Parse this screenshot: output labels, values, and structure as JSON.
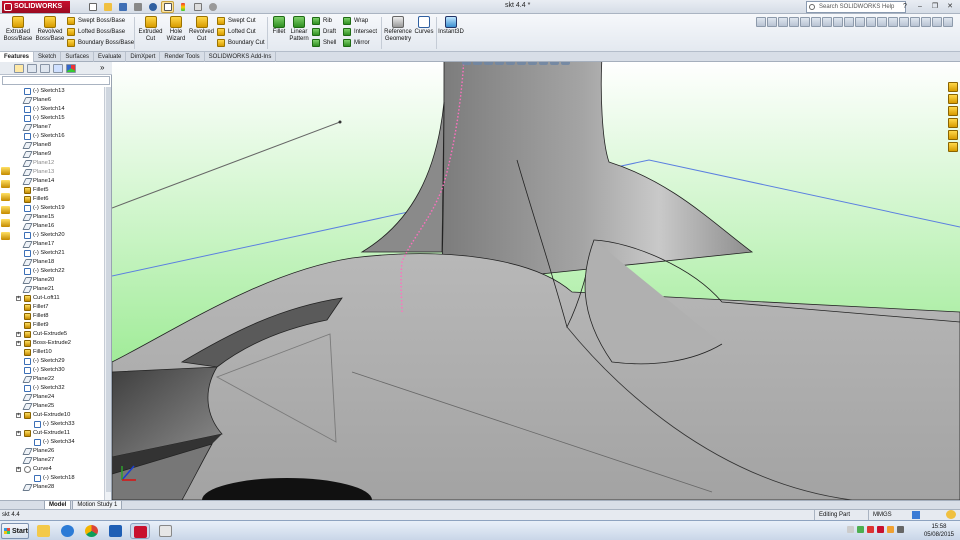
{
  "app": {
    "logo": "SOLIDWORKS",
    "doc_title": "skt 4.4 *"
  },
  "help_search": {
    "placeholder": "Search SOLIDWORKS Help"
  },
  "ribbon": {
    "extruded_boss": "Extruded Boss/Base",
    "revolved_boss": "Revolved Boss/Base",
    "swept_boss": "Swept Boss/Base",
    "lofted_boss": "Lofted Boss/Base",
    "boundary_boss": "Boundary Boss/Base",
    "extruded_cut": "Extruded Cut",
    "hole_wizard": "Hole Wizard",
    "revolved_cut": "Revolved Cut",
    "swept_cut": "Swept Cut",
    "lofted_cut": "Lofted Cut",
    "boundary_cut": "Boundary Cut",
    "fillet": "Fillet",
    "linear_pattern": "Linear Pattern",
    "rib": "Rib",
    "draft": "Draft",
    "shell": "Shell",
    "wrap": "Wrap",
    "intersect": "Intersect",
    "mirror": "Mirror",
    "reference_geometry": "Reference Geometry",
    "curves": "Curves",
    "instant3d": "Instant3D"
  },
  "tabs": [
    "Features",
    "Sketch",
    "Surfaces",
    "Evaluate",
    "DimXpert",
    "Render Tools",
    "SOLIDWORKS Add-Ins"
  ],
  "tree_items": [
    {
      "label": "(-) Sketch13",
      "type": "sketch"
    },
    {
      "label": "Plane6",
      "type": "plane"
    },
    {
      "label": "(-) Sketch14",
      "type": "sketch"
    },
    {
      "label": "(-) Sketch15",
      "type": "sketch"
    },
    {
      "label": "Plane7",
      "type": "plane"
    },
    {
      "label": "(-) Sketch16",
      "type": "sketch"
    },
    {
      "label": "Plane8",
      "type": "plane"
    },
    {
      "label": "Plane9",
      "type": "plane"
    },
    {
      "label": "Plane12",
      "type": "plane",
      "dim": true
    },
    {
      "label": "Plane13",
      "type": "plane",
      "dim": true
    },
    {
      "label": "Plane14",
      "type": "plane"
    },
    {
      "label": "Fillet5",
      "type": "feat"
    },
    {
      "label": "Fillet6",
      "type": "feat"
    },
    {
      "label": "(-) Sketch19",
      "type": "sketch"
    },
    {
      "label": "Plane15",
      "type": "plane"
    },
    {
      "label": "Plane16",
      "type": "plane"
    },
    {
      "label": "(-) Sketch20",
      "type": "sketch"
    },
    {
      "label": "Plane17",
      "type": "plane"
    },
    {
      "label": "(-) Sketch21",
      "type": "sketch"
    },
    {
      "label": "Plane18",
      "type": "plane"
    },
    {
      "label": "(-) Sketch22",
      "type": "sketch"
    },
    {
      "label": "Plane20",
      "type": "plane"
    },
    {
      "label": "Plane21",
      "type": "plane"
    },
    {
      "label": "Cut-Loft11",
      "type": "feat",
      "expand": true
    },
    {
      "label": "Fillet7",
      "type": "feat"
    },
    {
      "label": "Fillet8",
      "type": "feat"
    },
    {
      "label": "Fillet9",
      "type": "feat"
    },
    {
      "label": "Cut-Extrude5",
      "type": "feat",
      "expand": true
    },
    {
      "label": "Boss-Extrude2",
      "type": "feat",
      "expand": true
    },
    {
      "label": "Fillet10",
      "type": "feat"
    },
    {
      "label": "(-) Sketch29",
      "type": "sketch"
    },
    {
      "label": "(-) Sketch30",
      "type": "sketch"
    },
    {
      "label": "Plane22",
      "type": "plane"
    },
    {
      "label": "(-) Sketch32",
      "type": "sketch"
    },
    {
      "label": "Plane24",
      "type": "plane"
    },
    {
      "label": "Plane25",
      "type": "plane"
    },
    {
      "label": "Cut-Extrude10",
      "type": "feat",
      "expand": true
    },
    {
      "label": "(-) Sketch33",
      "type": "sketch",
      "indent": true
    },
    {
      "label": "Cut-Extrude11",
      "type": "feat",
      "expand": true
    },
    {
      "label": "(-) Sketch34",
      "type": "sketch",
      "indent": true
    },
    {
      "label": "Plane26",
      "type": "plane"
    },
    {
      "label": "Plane27",
      "type": "plane"
    },
    {
      "label": "Curve4",
      "type": "curve",
      "expand": true
    },
    {
      "label": "(-) Sketch18",
      "type": "sketch",
      "indent": true
    },
    {
      "label": "Plane28",
      "type": "plane"
    }
  ],
  "bottom_tabs": [
    "Model",
    "Motion Study 1"
  ],
  "status": {
    "left": "skt 4.4",
    "mode": "Editing Part",
    "units": "MMGS"
  },
  "taskbar": {
    "start": "Start",
    "time": "15:58",
    "date": "05/08/2015"
  },
  "colors": {
    "bg_top": "#ffffff",
    "bg_bottom": "#76e36a",
    "part": "#9a9a9a",
    "plane": "#5b7fe0",
    "curve": "#ff6fbf"
  }
}
